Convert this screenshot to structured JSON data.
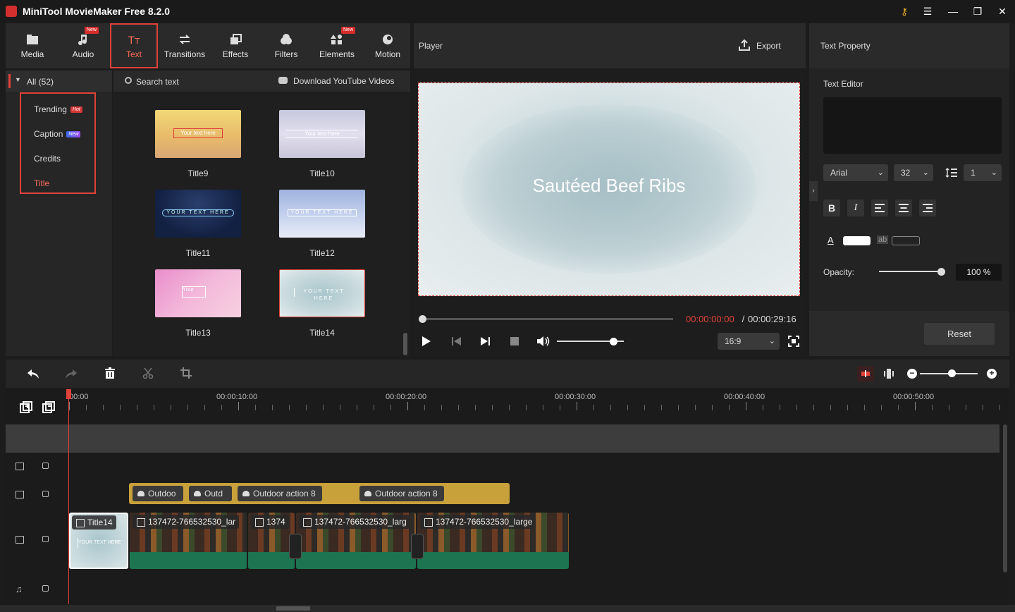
{
  "app": {
    "title": "MiniTool MovieMaker Free 8.2.0"
  },
  "tabs": [
    {
      "label": "Media",
      "icon": "folder-icon",
      "badge": ""
    },
    {
      "label": "Audio",
      "icon": "music-note-icon",
      "badge": "New"
    },
    {
      "label": "Text",
      "icon": "text-icon",
      "badge": ""
    },
    {
      "label": "Transitions",
      "icon": "transitions-icon",
      "badge": ""
    },
    {
      "label": "Effects",
      "icon": "effects-icon",
      "badge": ""
    },
    {
      "label": "Filters",
      "icon": "filters-icon",
      "badge": ""
    },
    {
      "label": "Elements",
      "icon": "elements-icon",
      "badge": "New"
    },
    {
      "label": "Motion",
      "icon": "motion-icon",
      "badge": ""
    }
  ],
  "library": {
    "all_label": "All (52)",
    "categories": [
      {
        "label": "Trending",
        "badge": "Hot"
      },
      {
        "label": "Caption",
        "badge": "New"
      },
      {
        "label": "Credits",
        "badge": ""
      },
      {
        "label": "Title",
        "badge": ""
      }
    ],
    "search_placeholder": "Search text",
    "download_label": "Download YouTube Videos",
    "items": [
      {
        "name": "Title9",
        "caption": "Your text here"
      },
      {
        "name": "Title10",
        "caption": "Your text here"
      },
      {
        "name": "Title11",
        "caption": "YOUR TEXT HERE"
      },
      {
        "name": "Title12",
        "caption": "YOUR TEXT HERE"
      },
      {
        "name": "Title13",
        "caption": "Your"
      },
      {
        "name": "Title14",
        "caption": "YOUR TEXT HERE"
      }
    ]
  },
  "player": {
    "label": "Player",
    "export_label": "Export",
    "preview_text": "Sautéed Beef Ribs",
    "current_time": "00:00:00:00",
    "separator": " / ",
    "total_time": "00:00:29:16",
    "aspect": "16:9",
    "progress": 0.0,
    "volume": 0.85
  },
  "text_property": {
    "title": "Text Property",
    "editor_label": "Text Editor",
    "font": "Arial",
    "size": "32",
    "line_spacing": "1",
    "opacity_label": "Opacity:",
    "opacity_value": "100 %",
    "opacity": 1.0,
    "reset_label": "Reset",
    "text_color": "#ffffff",
    "format_buttons": [
      "B",
      "I"
    ],
    "font_color_glyph": "A",
    "bg_glyph": "ab"
  },
  "timeline": {
    "zoom": 0.55,
    "ruler": [
      "00:00",
      "00:00:10:00",
      "00:00:20:00",
      "00:00:30:00",
      "00:00:40:00",
      "00:00:50:00"
    ],
    "effect_clips": [
      "Outdoo",
      "Outd",
      "Outdoor action 8",
      "Outdoor action 8"
    ],
    "text_clip": "Title14",
    "text_clip_overlay": "YOUR TEXT HERE",
    "video_clips": [
      "137472-766532530_lar",
      "1374",
      "137472-766532530_larg",
      "137472-766532530_large"
    ]
  },
  "colors": {
    "accent": "#e0423a",
    "clip_gold": "#c9a13a",
    "clip_green": "#1c7550"
  }
}
